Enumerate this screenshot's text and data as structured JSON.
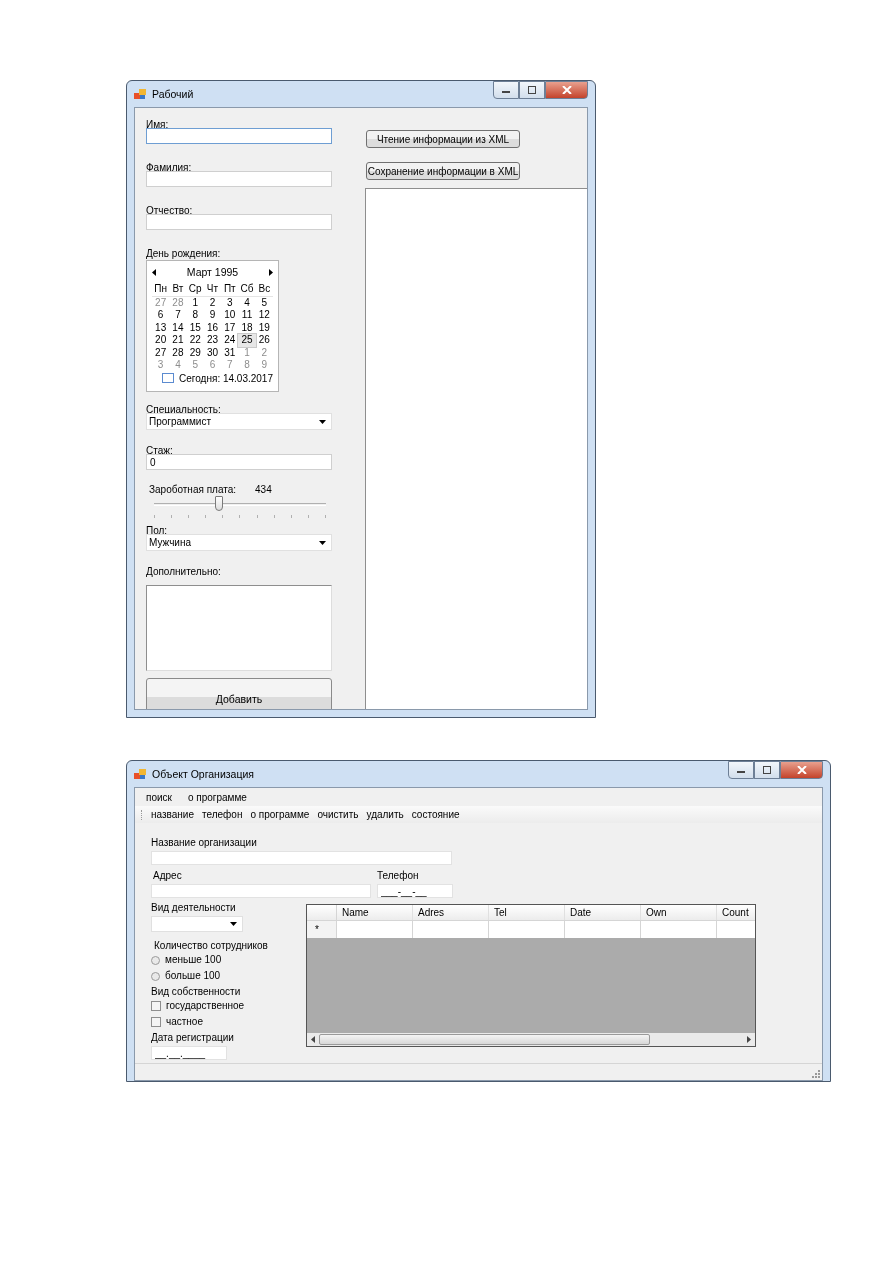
{
  "employee_window": {
    "title": "Рабочий",
    "fields": [
      {
        "label": "Имя:",
        "focused": true
      },
      {
        "label": "Фамилия:",
        "focused": false
      },
      {
        "label": "Отчество:",
        "focused": false
      }
    ],
    "birthday": {
      "label": "День рождения:",
      "month": "Март 1995",
      "weekdays": [
        "Пн",
        "Вт",
        "Ср",
        "Чт",
        "Пт",
        "Сб",
        "Вс"
      ],
      "weeks": [
        [
          {
            "day": "27",
            "other_month": true,
            "selected": false
          },
          {
            "day": "28",
            "other_month": true,
            "selected": false
          },
          {
            "day": "1",
            "other_month": false,
            "selected": false
          },
          {
            "day": "2",
            "other_month": false,
            "selected": false
          },
          {
            "day": "3",
            "other_month": false,
            "selected": false
          },
          {
            "day": "4",
            "other_month": false,
            "selected": false
          },
          {
            "day": "5",
            "other_month": false,
            "selected": false
          }
        ],
        [
          {
            "day": "6",
            "other_month": false,
            "selected": false
          },
          {
            "day": "7",
            "other_month": false,
            "selected": false
          },
          {
            "day": "8",
            "other_month": false,
            "selected": false
          },
          {
            "day": "9",
            "other_month": false,
            "selected": false
          },
          {
            "day": "10",
            "other_month": false,
            "selected": false
          },
          {
            "day": "11",
            "other_month": false,
            "selected": false
          },
          {
            "day": "12",
            "other_month": false,
            "selected": false
          }
        ],
        [
          {
            "day": "13",
            "other_month": false,
            "selected": false
          },
          {
            "day": "14",
            "other_month": false,
            "selected": false
          },
          {
            "day": "15",
            "other_month": false,
            "selected": false
          },
          {
            "day": "16",
            "other_month": false,
            "selected": false
          },
          {
            "day": "17",
            "other_month": false,
            "selected": false
          },
          {
            "day": "18",
            "other_month": false,
            "selected": false
          },
          {
            "day": "19",
            "other_month": false,
            "selected": false
          }
        ],
        [
          {
            "day": "20",
            "other_month": false,
            "selected": false
          },
          {
            "day": "21",
            "other_month": false,
            "selected": false
          },
          {
            "day": "22",
            "other_month": false,
            "selected": false
          },
          {
            "day": "23",
            "other_month": false,
            "selected": false
          },
          {
            "day": "24",
            "other_month": false,
            "selected": false
          },
          {
            "day": "25",
            "other_month": false,
            "selected": true
          },
          {
            "day": "26",
            "other_month": false,
            "selected": false
          }
        ],
        [
          {
            "day": "27",
            "other_month": false,
            "selected": false
          },
          {
            "day": "28",
            "other_month": false,
            "selected": false
          },
          {
            "day": "29",
            "other_month": false,
            "selected": false
          },
          {
            "day": "30",
            "other_month": false,
            "selected": false
          },
          {
            "day": "31",
            "other_month": false,
            "selected": false
          },
          {
            "day": "1",
            "other_month": true,
            "selected": false
          },
          {
            "day": "2",
            "other_month": true,
            "selected": false
          }
        ],
        [
          {
            "day": "3",
            "other_month": true,
            "selected": false
          },
          {
            "day": "4",
            "other_month": true,
            "selected": false
          },
          {
            "day": "5",
            "other_month": true,
            "selected": false
          },
          {
            "day": "6",
            "other_month": true,
            "selected": false
          },
          {
            "day": "7",
            "other_month": true,
            "selected": false
          },
          {
            "day": "8",
            "other_month": true,
            "selected": false
          },
          {
            "day": "9",
            "other_month": true,
            "selected": false
          }
        ]
      ],
      "today": "Сегодня: 14.03.2017"
    },
    "specialty": {
      "label": "Специальность:",
      "value": "Программист"
    },
    "experience": {
      "label": "Стаж:",
      "value": "0"
    },
    "salary": {
      "label": "Зароботная плата:",
      "reading": "434",
      "level": 0.38
    },
    "gender": {
      "label": "Пол:",
      "value": "Мужчина"
    },
    "additional": {
      "label": "Дополнительно:"
    },
    "add_button": "Добавить",
    "buttons": [
      "Чтение информации из XML",
      "Сохранение информации в XML"
    ]
  },
  "organization_window": {
    "title": "Объект  Организация",
    "menu": [
      "поиск",
      "о программе"
    ],
    "toolbar": [
      "название",
      "телефон",
      "о программе",
      "очистить",
      "удалить",
      "состояние"
    ],
    "name": {
      "label": "Название организации"
    },
    "address": {
      "label": "Адрес"
    },
    "phone": {
      "label": "Телефон",
      "value": "___-__-__"
    },
    "activity": {
      "label": "Вид деятельности"
    },
    "employees": {
      "label": "Количество сотрудников",
      "options": [
        {
          "label": "меньше 100",
          "selected": false
        },
        {
          "label": "больше 100",
          "selected": false
        }
      ]
    },
    "ownership": {
      "label": "Вид собственности",
      "options": [
        {
          "label": "государственное",
          "checked": false
        },
        {
          "label": "частное",
          "checked": false
        }
      ]
    },
    "registration_date": {
      "label": "Дата регистрации",
      "value": "__.__.____"
    },
    "table": {
      "columns": [
        "Name",
        "Adres",
        "Tel",
        "Date",
        "Own",
        "Count"
      ],
      "new_row_marker": "*"
    }
  }
}
